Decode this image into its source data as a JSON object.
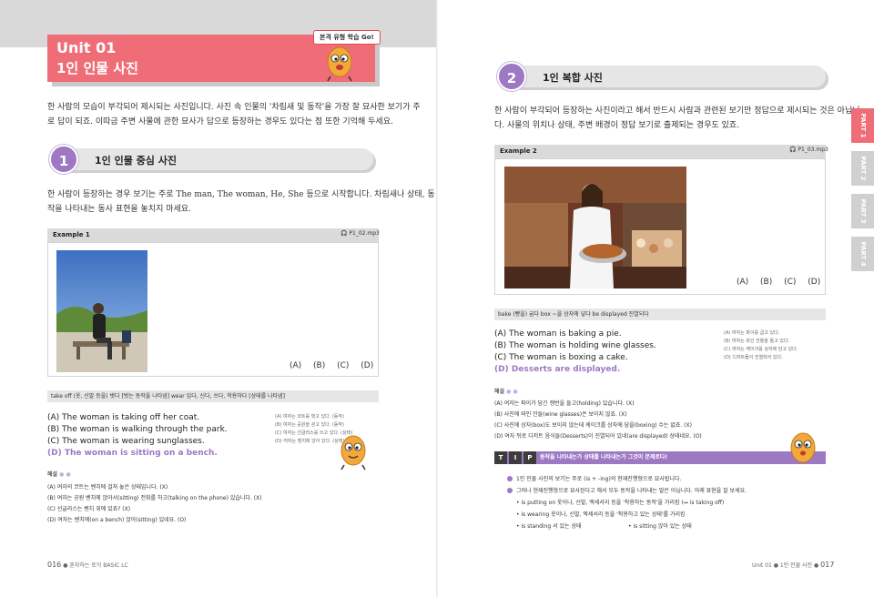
{
  "left_page": {
    "unit_number": "Unit 01",
    "unit_title": "1인 인물 사진",
    "badge": "본격 유형 학습 Go!",
    "intro_line1": "한 사람의 모습이 부각되어 제시되는 사진입니다. 사진 속 인물의 '차림새 및 동작'을 가장 잘 묘사한 보기가 주",
    "intro_line2": "로 답이 되죠. 이따금 주변 사물에 관한 묘사가 답으로 등장하는 경우도 있다는 점 또한 기억해 두세요.",
    "section_num": "1",
    "section_title": "1인 인물 중심 사진",
    "section_line1": "한 사람이 등장하는 경우 보기는 주로 The man, The woman, He, She 등으로 시작합니다. 차림새나 상태, 동",
    "section_line2": "작을 나타내는 동사 표현을 놓치지 마세요.",
    "example_label": "Example 1",
    "audio": "P1_02.mp3",
    "options": "(A) (B) (C) (D)",
    "vocab": "take off (옷, 신발 등을) 벗다 [벗는 동작을 나타냄]   wear 입다, 신다, 쓰다, 착용하다 [상태를 나타냄]",
    "choices": [
      "(A) The woman is taking off her coat.",
      "(B) The woman is walking through the park.",
      "(C) The woman is wearing sunglasses.",
      "(D) The woman is sitting on a bench."
    ],
    "choices_ko": [
      "(A) 여자는 코트를 벗고 있다. (동작)",
      "(B) 여자는 공원을 걷고 있다. (동작)",
      "(C) 여자는 선글라스를 쓰고 있다. (상태)",
      "(D) 여자는 벤치에 앉아 있다. (상태)"
    ],
    "explain_label": "해설",
    "explanations": [
      "(A) 여자의 코트는 벤치에 걸쳐 놓은 상태입니다. (X)",
      "(B) 여자는 공원 벤치에 앉아서(sitting) 전화를 하고(talking on the phone) 있습니다. (X)",
      "(C) 선글라스는 벤치 위에 있죠? (X)",
      "(D) 여자는 벤치에(on a bench) 앉아(sitting) 있네요. (O)"
    ],
    "footer_page": "016",
    "footer_title": "혼자하는 토익 BASIC LC"
  },
  "right_page": {
    "section_num": "2",
    "section_title": "1인 복합 사진",
    "intro_line1": "한 사람이 부각되어 등장하는 사진이라고 해서 반드시 사람과 관련된 보기만 정답으로 제시되는 것은 아닙니",
    "intro_line2": "다. 사물의 위치나 상태, 주변 배경이 정답 보기로 출제되는 경우도 있죠.",
    "example_label": "Example 2",
    "audio": "P1_03.mp3",
    "options": "(A) (B) (C) (D)",
    "vocab": "bake (빵을) 굽다   box ~을 상자에 넣다   be displayed 진열되다",
    "choices": [
      "(A) The woman is baking a pie.",
      "(B) The woman is holding wine glasses.",
      "(C) The woman is boxing a cake.",
      "(D) Desserts are displayed."
    ],
    "choices_ko": [
      "(A) 여자는 파이를 굽고 있다.",
      "(B) 여자는 와인 잔들을 들고 있다.",
      "(C) 여자는 케이크를 상자에 담고 있다.",
      "(D) 디저트들이 진열되어 있다."
    ],
    "explain_label": "해설",
    "explanations": [
      "(A) 여자는 파이가 담긴 쟁반을 들고(holding) 있습니다. (X)",
      "(B) 사진에 와인 잔들(wine glasses)은 보이지 않죠. (X)",
      "(C) 사진에 상자(box)도 보이지 않는데 케이크를 상자에 담을(boxing) 수는 없죠. (X)",
      "(D) 여자 뒤로 디저트 음식들(Desserts)이 진열되어 있네(are displayed) 상태네요. (O)"
    ],
    "tip_t": "T",
    "tip_i": "I",
    "tip_p": "P",
    "tip_title": "동작을 나타내는가 상태를 나타내는가 그것이 문제로다!",
    "tip_lines": [
      "1인 인물 사진의 보기는 주로 (is + -ing)의 현재진행형으로 묘사됩니다.",
      "그러나 현재진행형으로 묘사된다고 해서 모두 동작을 나타내는 말은 아닙니다. 아래 표현을 잘 보세요.",
      "• is putting on 옷이나, 신발, 액세서리 등을 '착용하는 동작'을 가리킴 (↔ is taking off)",
      "• is wearing 옷이나, 신발, 액세서리 등을 '착용하고 있는 상태'를 가리킴",
      "• is standing 서 있는 상태",
      "• is sitting 앉아 있는 상태"
    ],
    "footer_unit": "Unit 01",
    "footer_title": "1인 인물 사진",
    "footer_page": "017"
  },
  "side_tabs": [
    "PART 1",
    "PART 2",
    "PART 3",
    "PART 4"
  ],
  "colors": {
    "unit_banner": "#ef6d77",
    "accent_purple": "#9d78c3",
    "side_tab_active": "#ef6d77",
    "side_tab_inactive": "#d0d0d0"
  },
  "icons": {
    "mascot": "cartoon-egg-mascot",
    "audio": "headphones-icon"
  }
}
